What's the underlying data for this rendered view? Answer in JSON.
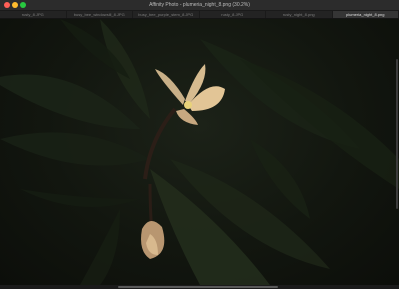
{
  "app": {
    "window_title": "Affinity Photo - plumeria_night_8.png (30.2%)"
  },
  "tabs": [
    {
      "label": "rusty_8.JPG",
      "active": false
    },
    {
      "label": "busy_bee_windowsill_8.JPG",
      "active": false
    },
    {
      "label": "busy_bee_purple_stem_8.JPG",
      "active": false
    },
    {
      "label": "rusty_8.JPG",
      "active": false
    },
    {
      "label": "rusty_night_8.png",
      "active": false
    },
    {
      "label": "plumeria_night_8.png",
      "active": true
    }
  ],
  "canvas": {
    "image_name": "plumeria_night_8.png",
    "zoom": "30.2%"
  },
  "colors": {
    "close": "#ff5f57",
    "minimize": "#febc2e",
    "zoom": "#28c840",
    "active_tab": "#353535"
  }
}
